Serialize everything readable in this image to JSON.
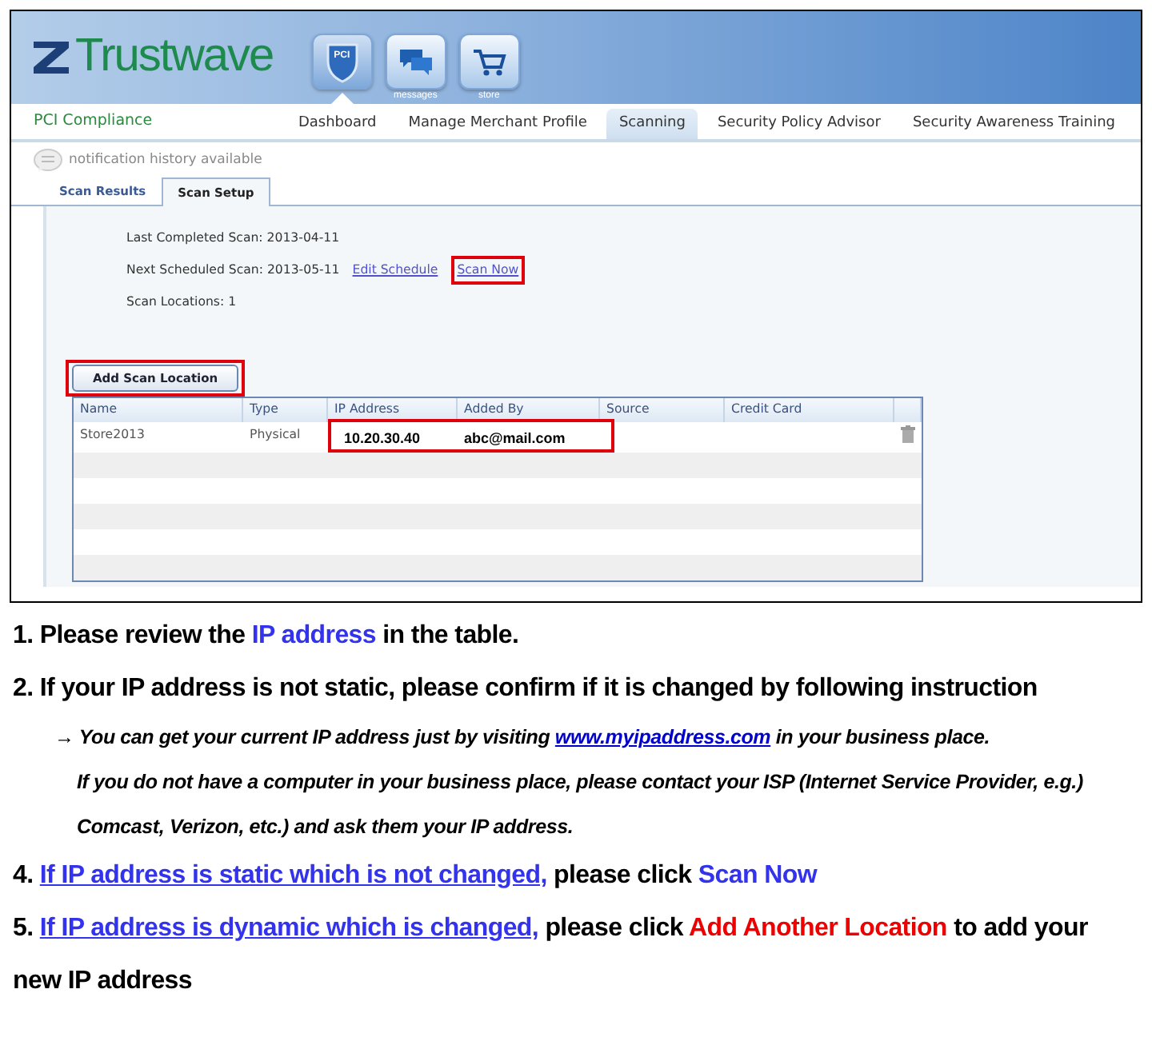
{
  "logo": {
    "text": "Trustwave"
  },
  "app_tiles": [
    {
      "kind": "shield",
      "label": "PCI",
      "selected": true
    },
    {
      "kind": "chat",
      "label": "messages",
      "selected": false
    },
    {
      "kind": "cart",
      "label": "store",
      "selected": false
    }
  ],
  "product": "PCI Compliance",
  "nav": [
    {
      "label": "Dashboard",
      "selected": false
    },
    {
      "label": "Manage Merchant Profile",
      "selected": false
    },
    {
      "label": "Scanning",
      "selected": true
    },
    {
      "label": "Security Policy Advisor",
      "selected": false
    },
    {
      "label": "Security Awareness Training",
      "selected": false
    }
  ],
  "notification": "notification history available",
  "tabs": [
    {
      "label": "Scan Results",
      "selected": false
    },
    {
      "label": "Scan Setup",
      "selected": true
    }
  ],
  "scan_info": [
    {
      "text": "Last Completed Scan: 2013-04-11"
    },
    {
      "text": "Next Scheduled Scan: 2013-05-11",
      "links": [
        {
          "text": "Edit Schedule",
          "highlighted": false
        },
        {
          "text": "Scan Now",
          "highlighted": true
        }
      ]
    },
    {
      "text": "Scan Locations: 1"
    }
  ],
  "add_button": {
    "label": "Add Scan Location",
    "highlighted": true
  },
  "table": {
    "columns": [
      "Name",
      "Type",
      "IP Address",
      "Added By",
      "Source",
      "Credit Card"
    ],
    "rows": [
      {
        "cells": [
          {
            "text": "Store2013",
            "highlighted": false
          },
          {
            "text": "Physical",
            "highlighted": false
          },
          {
            "text": "10.20.30.40",
            "highlighted": true
          },
          {
            "text": "abc@mail.com",
            "highlighted": true
          }
        ],
        "deletable": true
      }
    ]
  },
  "instructions": [
    {
      "kind": "step",
      "segments": [
        {
          "kind": "text",
          "text": "1. Please review the "
        },
        {
          "kind": "highlight",
          "text": "IP address"
        },
        {
          "kind": "text",
          "text": " in the table."
        }
      ]
    },
    {
      "kind": "step",
      "segments": [
        {
          "kind": "text",
          "text": "2. If your IP address is not static, please confirm if it is changed by following instruction"
        }
      ]
    },
    {
      "kind": "note",
      "segments": [
        {
          "kind": "text",
          "text": "→ You can get your current IP address  just by visiting "
        },
        {
          "kind": "link",
          "text": "www.myipaddress.com"
        },
        {
          "kind": "text",
          "text": "  in your business  place.\nIf you do not have a computer in your business  place, please contact your ISP (Internet Service Provider, e.g.) Comcast, Verizon, etc.) and ask them your IP address."
        }
      ]
    },
    {
      "kind": "step",
      "segments": [
        {
          "kind": "text",
          "text": "4. "
        },
        {
          "kind": "link",
          "text": "If IP address is static which is not changed,"
        },
        {
          "kind": "text",
          "text": "  please click "
        },
        {
          "kind": "highlight",
          "text": "Scan Now"
        }
      ]
    },
    {
      "kind": "step",
      "segments": [
        {
          "kind": "text",
          "text": "5. "
        },
        {
          "kind": "link",
          "text": "If IP address is dynamic which is changed,"
        },
        {
          "kind": "text",
          "text": "  please click "
        },
        {
          "kind": "alert",
          "text": "Add Another Location"
        },
        {
          "kind": "text",
          "text": " to add your new IP address"
        }
      ]
    }
  ]
}
